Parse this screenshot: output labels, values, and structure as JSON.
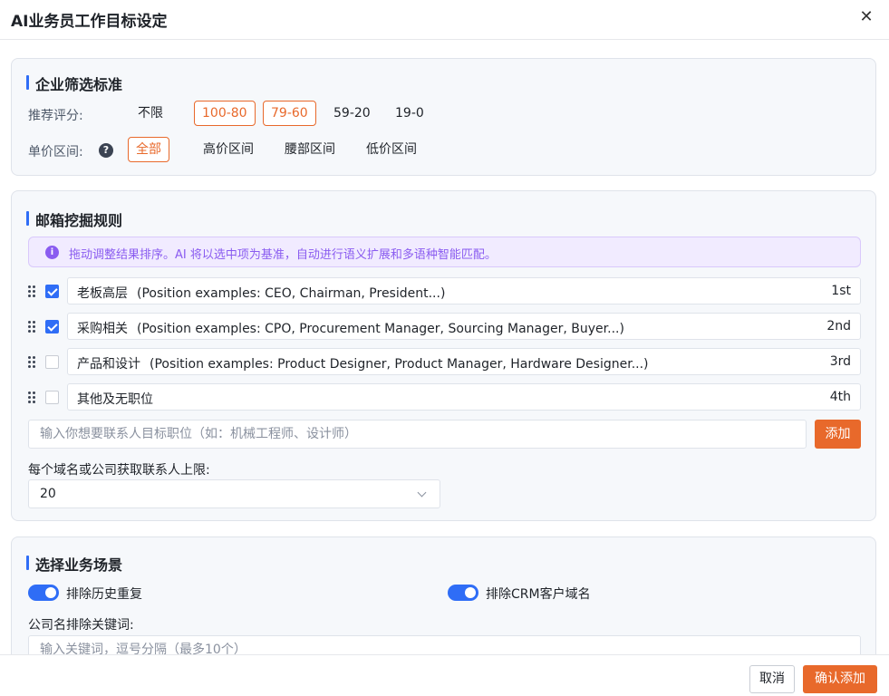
{
  "dialog": {
    "title": "AI业务员工作目标设定",
    "close_icon": "close-icon",
    "close_glyph": "✕"
  },
  "company_filter": {
    "title": "企业筛选标准",
    "score": {
      "label": "推荐评分:",
      "options": [
        {
          "label": "不限",
          "active": false
        },
        {
          "label": "100-80",
          "active": true
        },
        {
          "label": "79-60",
          "active": true
        },
        {
          "label": "59-20",
          "active": false
        },
        {
          "label": "19-0",
          "active": false
        }
      ]
    },
    "price": {
      "label": "单价区间:",
      "help_icon": "question-circle-icon",
      "help_glyph": "?",
      "options": [
        {
          "label": "全部",
          "active": true
        },
        {
          "label": "高价区间",
          "active": false
        },
        {
          "label": "腰部区间",
          "active": false
        },
        {
          "label": "低价区间",
          "active": false
        }
      ]
    }
  },
  "email_rules": {
    "title": "邮箱挖掘规则",
    "info_icon": "info-circle-icon",
    "info_glyph": "i",
    "info": "拖动调整结果排序。AI 将以选中项为基准，自动进行语义扩展和多语种智能匹配。",
    "positions": [
      {
        "name": "老板高层",
        "examples": "(Position examples: CEO, Chairman, President...)",
        "rank": "1st",
        "checked": true
      },
      {
        "name": "采购相关",
        "examples": "(Position examples: CPO, Procurement Manager, Sourcing Manager, Buyer...)",
        "rank": "2nd",
        "checked": true
      },
      {
        "name": "产品和设计",
        "examples": "(Position examples: Product Designer, Product Manager, Hardware Designer...)",
        "rank": "3rd",
        "checked": false
      },
      {
        "name": "其他及无职位",
        "examples": "",
        "rank": "4th",
        "checked": false
      }
    ],
    "target_input": {
      "placeholder": "输入你想要联系人目标职位（如：机械工程师、设计师）",
      "value": ""
    },
    "add_label": "添加",
    "limit_label": "每个域名或公司获取联系人上限:",
    "limit_value": "20"
  },
  "scenario": {
    "title": "选择业务场景",
    "toggles": [
      {
        "label": "排除历史重复",
        "on": true
      },
      {
        "label": "排除CRM客户域名",
        "on": true
      }
    ],
    "exclude_label": "公司名排除关键词:",
    "exclude_input": {
      "placeholder": "输入关键词，逗号分隔（最多10个）",
      "value": ""
    }
  },
  "footer": {
    "cancel_label": "取消",
    "confirm_label": "确认添加"
  },
  "colors": {
    "accent_orange": "#e8692b",
    "accent_blue": "#2f6df6",
    "info_purple": "#8a5cf0"
  }
}
